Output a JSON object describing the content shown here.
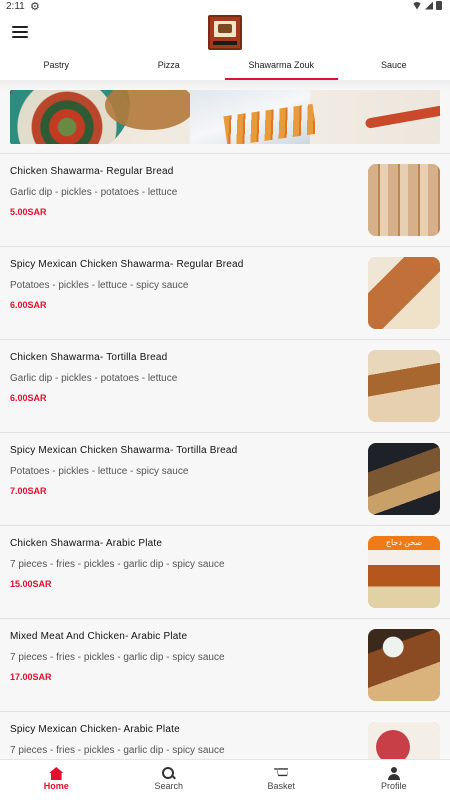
{
  "status_bar": {
    "time": "2:11",
    "settings_icon": "gear-icon"
  },
  "header": {
    "menu_icon": "hamburger-menu-icon",
    "logo": "restaurant-logo"
  },
  "tabs": [
    {
      "label": "Pastry",
      "active": false
    },
    {
      "label": "Pizza",
      "active": false
    },
    {
      "label": "Shawarma Zouk",
      "active": true
    },
    {
      "label": "Sauce",
      "active": false
    }
  ],
  "products": [
    {
      "name": "Chicken Shawarma- Regular Bread",
      "description": "Garlic dip - pickles - potatoes - lettuce",
      "price": "5.00SAR"
    },
    {
      "name": "Spicy Mexican Chicken Shawarma- Regular Bread",
      "description": "Potatoes - pickles - lettuce - spicy sauce",
      "price": "6.00SAR"
    },
    {
      "name": "Chicken Shawarma- Tortilla Bread",
      "description": "Garlic dip - pickles - potatoes - lettuce",
      "price": "6.00SAR"
    },
    {
      "name": "Spicy Mexican Chicken Shawarma- Tortilla Bread",
      "description": "Potatoes - pickles - lettuce - spicy sauce",
      "price": "7.00SAR"
    },
    {
      "name": "Chicken Shawarma- Arabic Plate",
      "description": "7 pieces - fries - pickles - garlic dip - spicy sauce",
      "price": "15.00SAR",
      "image_text": "صحن دجاج"
    },
    {
      "name": "Mixed Meat And Chicken- Arabic Plate",
      "description": "7 pieces - fries - pickles - garlic dip - spicy sauce",
      "price": "17.00SAR"
    },
    {
      "name": "Spicy Mexican Chicken- Arabic Plate",
      "description": "7 pieces - fries - pickles - garlic dip - spicy sauce",
      "price": ""
    }
  ],
  "bottom_nav": [
    {
      "label": "Home",
      "icon": "home-icon",
      "active": true
    },
    {
      "label": "Search",
      "icon": "search-icon",
      "active": false
    },
    {
      "label": "Basket",
      "icon": "basket-icon",
      "active": false
    },
    {
      "label": "Profile",
      "icon": "profile-icon",
      "active": false
    }
  ],
  "colors": {
    "accent": "#e0102e",
    "background": "#f7f7f7"
  }
}
